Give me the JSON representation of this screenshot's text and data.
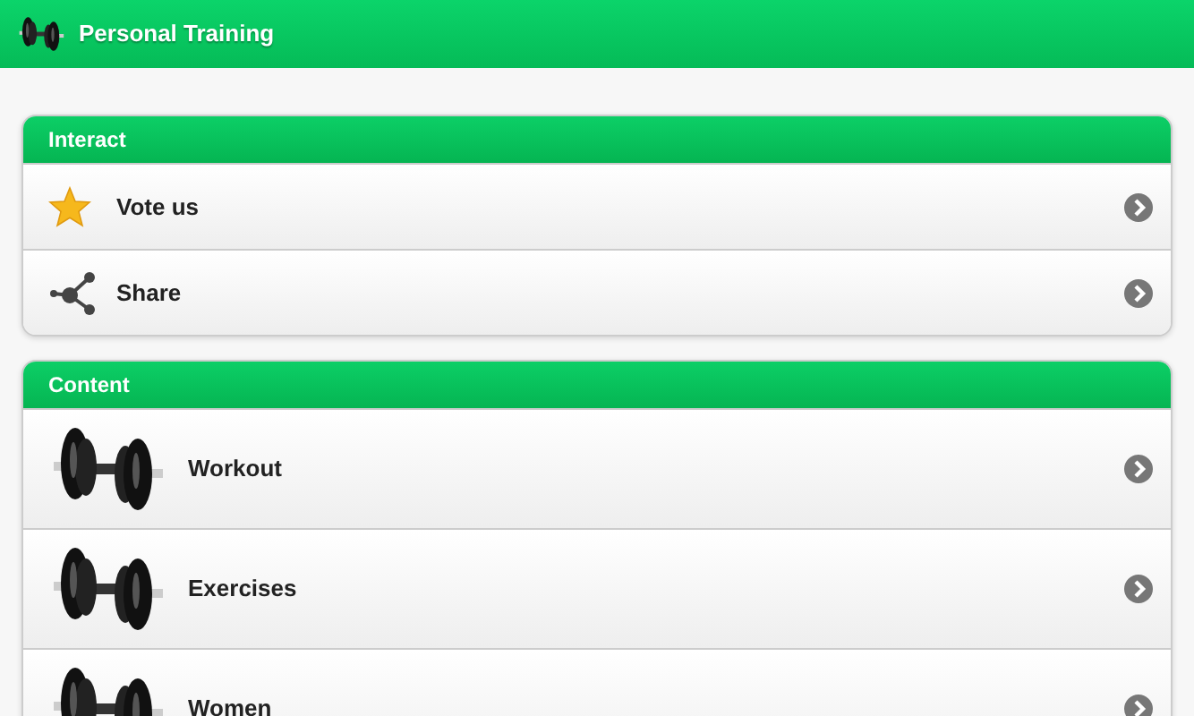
{
  "app_bar": {
    "title": "Personal Training"
  },
  "sections": [
    {
      "title": "Interact",
      "items": [
        {
          "label": "Vote us",
          "kind": "star"
        },
        {
          "label": "Share",
          "kind": "share"
        }
      ]
    },
    {
      "title": "Content",
      "items": [
        {
          "label": "Workout",
          "kind": "dumbbell"
        },
        {
          "label": "Exercises",
          "kind": "dumbbell"
        },
        {
          "label": "Women",
          "kind": "dumbbell"
        }
      ]
    }
  ]
}
